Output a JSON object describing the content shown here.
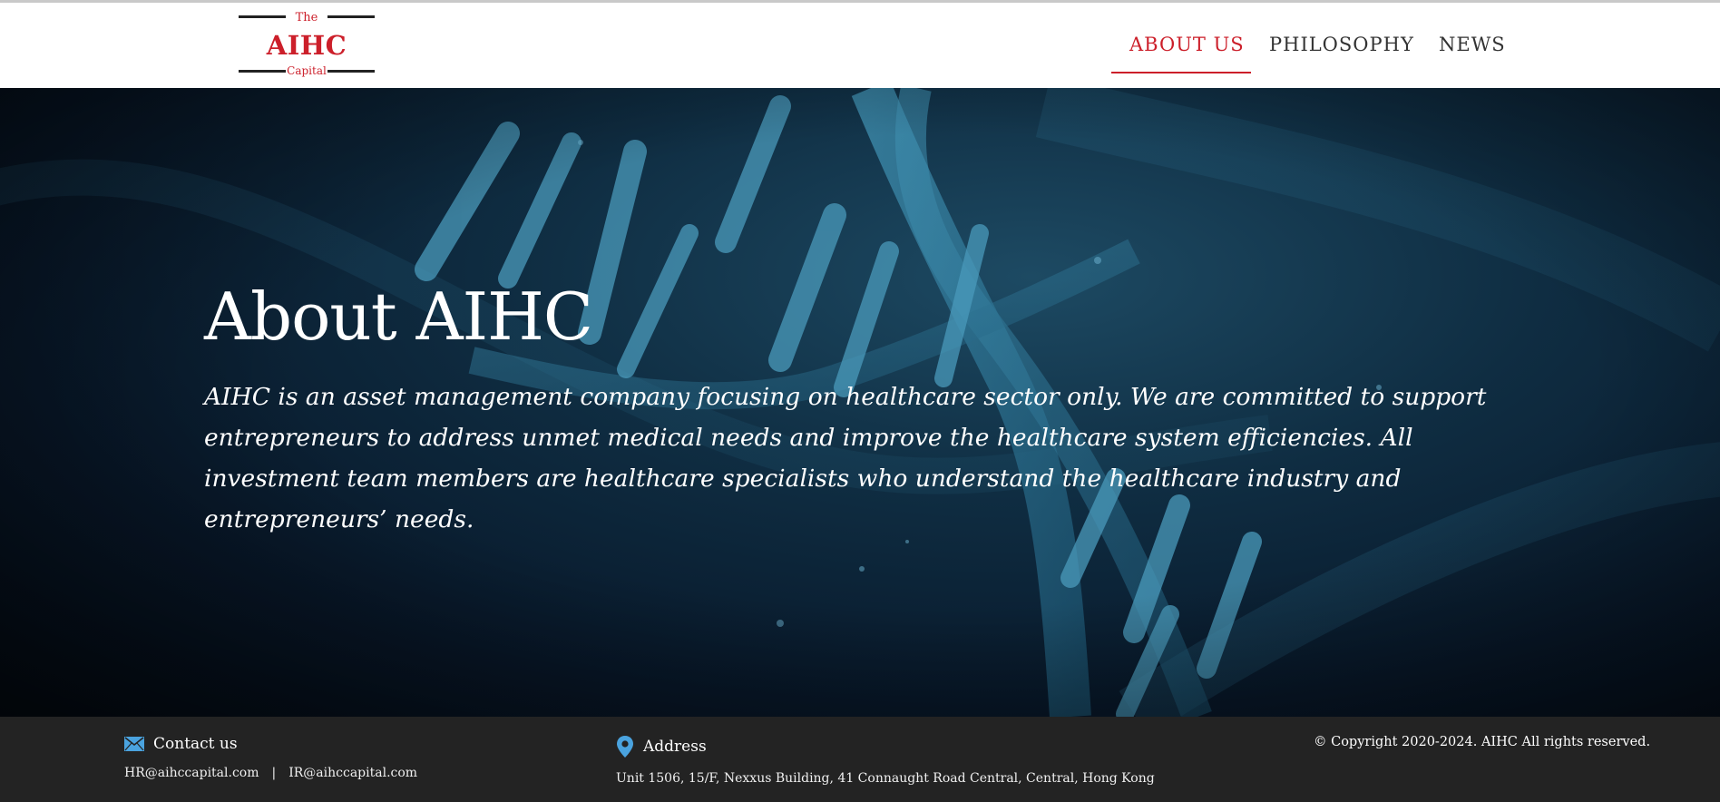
{
  "brand": {
    "top_word": "The",
    "name": "AIHC",
    "bottom_word": "Capital",
    "accent_color": "#cc1f2a"
  },
  "nav": {
    "items": [
      {
        "label": "ABOUT US",
        "active": true
      },
      {
        "label": "PHILOSOPHY",
        "active": false
      },
      {
        "label": "NEWS",
        "active": false
      }
    ]
  },
  "hero": {
    "title": "About AIHC",
    "body": "AIHC is an asset management company focusing on healthcare sector only. We are committed to support entrepreneurs to address unmet medical needs and improve the healthcare system efficiencies. All investment team members are healthcare specialists who understand the healthcare industry and entrepreneurs’ needs.",
    "background_image": "dna-helix"
  },
  "footer": {
    "contact": {
      "icon": "mail-icon",
      "heading": "Contact us",
      "email_hr": "HR@aihccapital.com",
      "separator": "|",
      "email_ir": "IR@aihccapital.com"
    },
    "address": {
      "icon": "location-pin-icon",
      "heading": "Address",
      "text": "Unit 1506, 15/F, Nexxus Building, 41 Connaught Road Central, Central, Hong Kong"
    },
    "copyright": "© Copyright 2020-2024. AIHC All rights reserved.",
    "icon_color": "#4aa3df"
  }
}
